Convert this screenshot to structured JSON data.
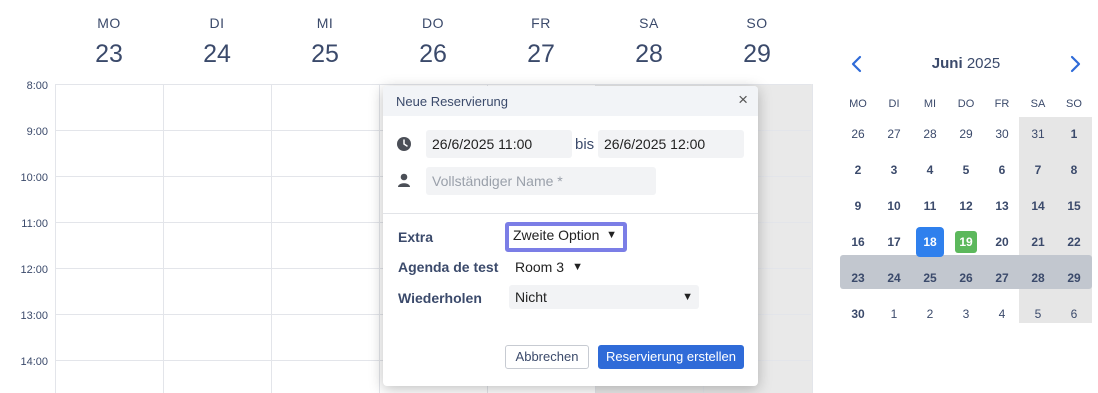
{
  "week": {
    "days": [
      {
        "dow": "MO",
        "num": "23"
      },
      {
        "dow": "DI",
        "num": "24"
      },
      {
        "dow": "MI",
        "num": "25"
      },
      {
        "dow": "DO",
        "num": "26"
      },
      {
        "dow": "FR",
        "num": "27"
      },
      {
        "dow": "SA",
        "num": "28"
      },
      {
        "dow": "SO",
        "num": "29"
      }
    ],
    "times": [
      "8:00",
      "9:00",
      "10:00",
      "11:00",
      "12:00",
      "13:00",
      "14:00"
    ]
  },
  "mini_calendar": {
    "month": "Juni",
    "year": "2025",
    "dow": [
      "MO",
      "DI",
      "MI",
      "DO",
      "FR",
      "SA",
      "SO"
    ],
    "weeks": [
      [
        "26",
        "27",
        "28",
        "29",
        "30",
        "31",
        "1"
      ],
      [
        "2",
        "3",
        "4",
        "5",
        "6",
        "7",
        "8"
      ],
      [
        "9",
        "10",
        "11",
        "12",
        "13",
        "14",
        "15"
      ],
      [
        "16",
        "17",
        "18",
        "19",
        "20",
        "21",
        "22"
      ],
      [
        "23",
        "24",
        "25",
        "26",
        "27",
        "28",
        "29"
      ],
      [
        "30",
        "1",
        "2",
        "3",
        "4",
        "5",
        "6"
      ]
    ],
    "today": "18",
    "highlight": "19",
    "colors": {
      "today": "#2f80ed",
      "highlight": "#5cb85c",
      "selected_week": "#c2c7cf"
    }
  },
  "modal": {
    "title": "Neue Reservierung",
    "close": "×",
    "start": "26/6/2025  11:00",
    "bis": "bis",
    "end": "26/6/2025  12:00",
    "name_placeholder": "Vollständiger Name *",
    "extra_label": "Extra",
    "extra_value": "Zweite Option",
    "agenda_label": "Agenda de test",
    "agenda_value": "Room 3",
    "repeat_label": "Wiederholen",
    "repeat_value": "Nicht",
    "cancel": "Abbrechen",
    "submit": "Reservierung erstellen"
  }
}
